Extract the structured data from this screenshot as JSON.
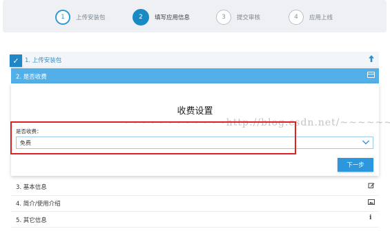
{
  "stepper": {
    "steps": [
      {
        "number": "1",
        "label": "上传安装包"
      },
      {
        "number": "2",
        "label": "填写应用信息"
      },
      {
        "number": "3",
        "label": "提交审核"
      },
      {
        "number": "4",
        "label": "应用上线"
      }
    ]
  },
  "accordion": {
    "row1_label": "1. 上传安装包",
    "row2_label": "2. 是否收费",
    "row3_label": "3. 基本信息",
    "row4_label": "4. 简介/使用介绍",
    "row5_label": "5. 其它信息"
  },
  "charge": {
    "title": "收费设置",
    "watermark": "~~~~~~~~~~~~http://blog.csdn.net/~~~~~~~~~~~",
    "field_label": "是否收费：",
    "selected_value": "免费",
    "next_label": "下一步"
  },
  "colors": {
    "accent": "#1a8ac4",
    "active_row": "#52afe8",
    "highlight_box": "#e02020"
  }
}
